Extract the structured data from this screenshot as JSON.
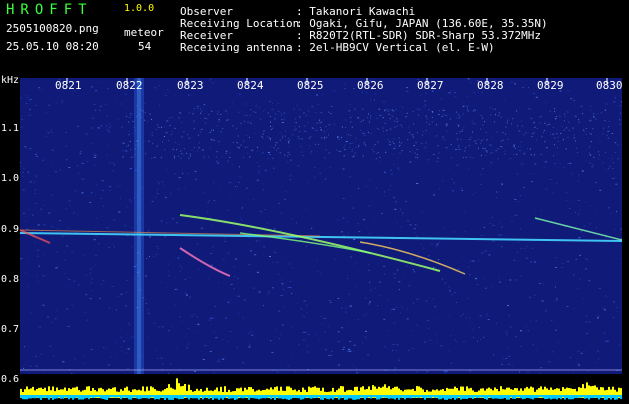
{
  "header": {
    "app_title": "HROFFT",
    "version": "1.0.0",
    "filename": "2505100820.png",
    "datetime": "25.05.10 08:20",
    "meteor_label": "meteor",
    "meteor_count": "54"
  },
  "info": [
    {
      "key": "Observer",
      "value": ": Takanori Kawachi"
    },
    {
      "key": "Receiving Location",
      "value": ": Ogaki, Gifu, JAPAN (136.60E, 35.35N)"
    },
    {
      "key": "Receiver",
      "value": ": R820T2(RTL-SDR) SDR-Sharp 53.372MHz"
    },
    {
      "key": "Receiving antenna",
      "value": ": 2el-HB9CV Vertical (el. E-W)"
    }
  ],
  "axis": {
    "y_unit": "kHz",
    "y_labels": [
      "1.1",
      "1.0",
      "0.9",
      "0.8",
      "0.7",
      "0.6"
    ],
    "x_labels": [
      "0821",
      "0822",
      "0823",
      "0824",
      "0825",
      "0826",
      "0827",
      "0828",
      "0829",
      "0830"
    ]
  },
  "colors": {
    "background": "#000000",
    "spectrogram_bg": "#101a78",
    "label_white": "#ffffff",
    "title_green": "#39ff39",
    "level_yellow": "#ffff00",
    "level_cyan": "#00c8ff"
  }
}
